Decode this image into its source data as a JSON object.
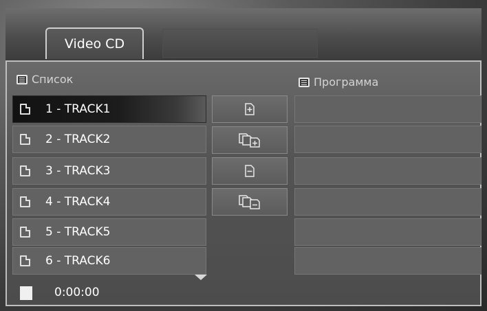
{
  "tab": {
    "label": "Video CD"
  },
  "left_panel": {
    "header": "Список"
  },
  "right_panel": {
    "header": "Программа"
  },
  "tracks": [
    {
      "label": "1 - TRACK1"
    },
    {
      "label": "2 - TRACK2"
    },
    {
      "label": "3 - TRACK3"
    },
    {
      "label": "4 - TRACK4"
    },
    {
      "label": "5 - TRACK5"
    },
    {
      "label": "6 - TRACK6"
    }
  ],
  "selected_track_index": 0,
  "buttons": [
    {
      "icon": "add-file-icon"
    },
    {
      "icon": "add-all-files-icon"
    },
    {
      "icon": "remove-file-icon"
    },
    {
      "icon": "remove-all-files-icon"
    }
  ],
  "playback": {
    "time": "0:00:00",
    "status_icon": "stop-icon"
  }
}
